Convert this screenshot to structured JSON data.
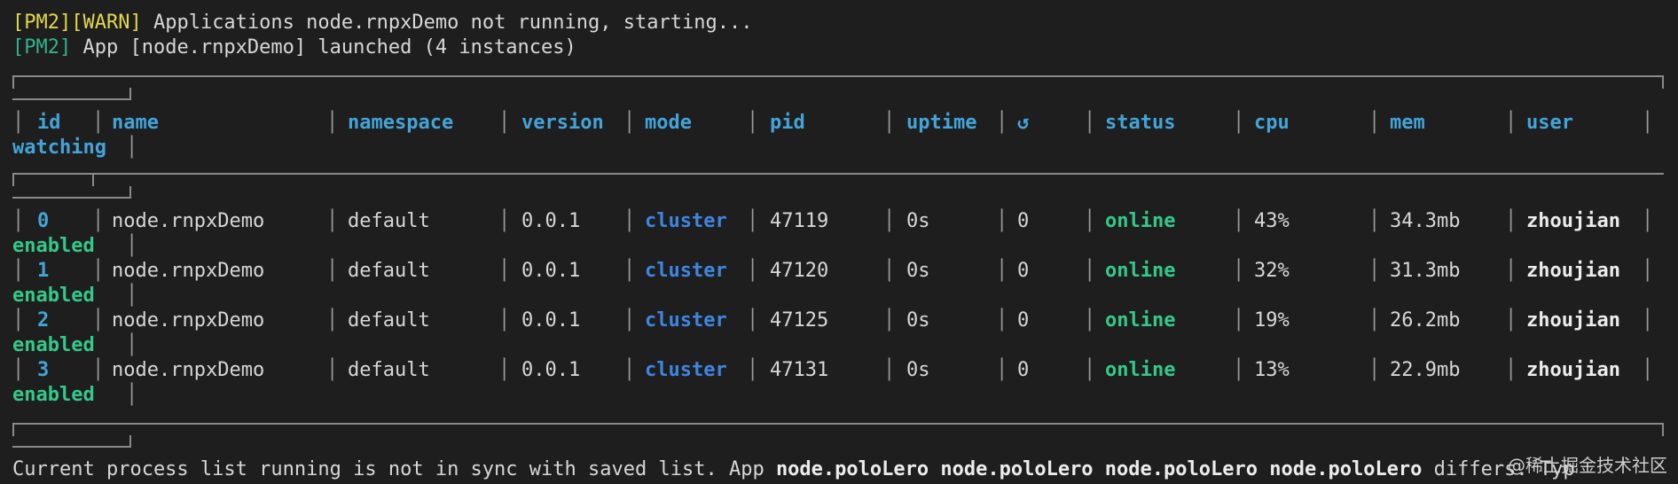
{
  "messages": {
    "line1_tag1": "[PM2]",
    "line1_tag2": "[WARN]",
    "line1_text": " Applications node.rnpxDemo not running, starting...",
    "line2_tag": "[PM2]",
    "line2_text": " App [node.rnpxDemo] launched (4 instances)"
  },
  "table": {
    "headers": {
      "id": "id",
      "name": "name",
      "namespace": "namespace",
      "version": "version",
      "mode": "mode",
      "pid": "pid",
      "uptime": "uptime",
      "restart": "↺",
      "status": "status",
      "cpu": "cpu",
      "mem": "mem",
      "user": "user",
      "watching": "watching"
    },
    "rows": [
      {
        "id": "0",
        "name": "node.rnpxDemo",
        "namespace": "default",
        "version": "0.0.1",
        "mode": "cluster",
        "pid": "47119",
        "uptime": "0s",
        "restarts": "0",
        "status": "online",
        "cpu": "43%",
        "mem": "34.3mb",
        "user": "zhoujian",
        "watching": "enabled"
      },
      {
        "id": "1",
        "name": "node.rnpxDemo",
        "namespace": "default",
        "version": "0.0.1",
        "mode": "cluster",
        "pid": "47120",
        "uptime": "0s",
        "restarts": "0",
        "status": "online",
        "cpu": "32%",
        "mem": "31.3mb",
        "user": "zhoujian",
        "watching": "enabled"
      },
      {
        "id": "2",
        "name": "node.rnpxDemo",
        "namespace": "default",
        "version": "0.0.1",
        "mode": "cluster",
        "pid": "47125",
        "uptime": "0s",
        "restarts": "0",
        "status": "online",
        "cpu": "19%",
        "mem": "26.2mb",
        "user": "zhoujian",
        "watching": "enabled"
      },
      {
        "id": "3",
        "name": "node.rnpxDemo",
        "namespace": "default",
        "version": "0.0.1",
        "mode": "cluster",
        "pid": "47131",
        "uptime": "0s",
        "restarts": "0",
        "status": "online",
        "cpu": "13%",
        "mem": "22.9mb",
        "user": "zhoujian",
        "watching": "enabled"
      }
    ]
  },
  "footer": {
    "text1": "Current process list running is not in sync with saved list. App ",
    "apps": "node.poloLero node.poloLero node.poloLero node.poloLero",
    "text2": " differs. Typ"
  },
  "watermark": "@稀土掘金技术社区"
}
